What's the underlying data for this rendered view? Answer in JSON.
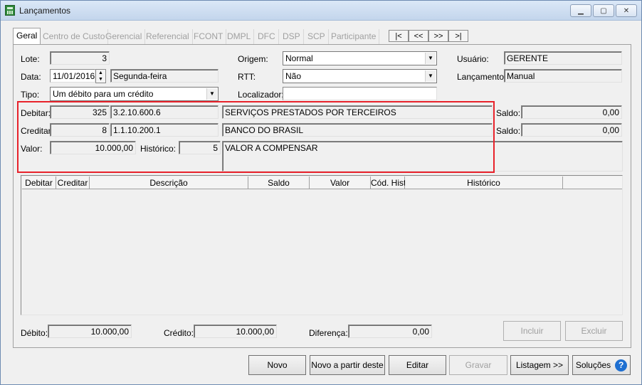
{
  "window": {
    "title": "Lançamentos"
  },
  "tabs": [
    "Geral",
    "Centro de Custo",
    "Gerencial",
    "Referencial",
    "FCONT",
    "DMPL",
    "DFC",
    "DSP",
    "SCP",
    "Participante"
  ],
  "nav": {
    "first": "|<",
    "prev": "<<",
    "next": ">>",
    "last": ">|"
  },
  "form": {
    "lote_label": "Lote:",
    "lote_value": "3",
    "data_label": "Data:",
    "data_value": "11/01/2016",
    "weekday": "Segunda-feira",
    "tipo_label": "Tipo:",
    "tipo_value": "Um débito para um crédito",
    "origem_label": "Origem:",
    "origem_value": "Normal",
    "rtt_label": "RTT:",
    "rtt_value": "Não",
    "localizador_label": "Localizador:",
    "localizador_value": "",
    "usuario_label": "Usuário:",
    "usuario_value": "GERENTE",
    "lancamento_label": "Lançamento:",
    "lancamento_value": "Manual"
  },
  "entry": {
    "debitar_label": "Debitar:",
    "debitar_code": "325",
    "debitar_account": "3.2.10.600.6",
    "debitar_desc": "SERVIÇOS PRESTADOS POR TERCEIROS",
    "creditar_label": "Creditar:",
    "creditar_code": "8",
    "creditar_account": "1.1.10.200.1",
    "creditar_desc": "BANCO DO BRASIL",
    "valor_label": "Valor:",
    "valor_value": "10.000,00",
    "historico_label": "Histórico:",
    "historico_code": "5",
    "historico_desc": "VALOR A COMPENSAR",
    "saldo_label": "Saldo:",
    "saldo_debitar": "0,00",
    "saldo_creditar": "0,00"
  },
  "grid": {
    "columns": [
      "Debitar",
      "Creditar",
      "Descrição",
      "Saldo",
      "Valor",
      "Cód. Hist.",
      "Histórico"
    ]
  },
  "totals": {
    "debito_label": "Débito:",
    "debito_value": "10.000,00",
    "credito_label": "Crédito:",
    "credito_value": "10.000,00",
    "diferenca_label": "Diferença:",
    "diferenca_value": "0,00"
  },
  "buttons": {
    "incluir": "Incluir",
    "excluir": "Excluir",
    "novo": "Novo",
    "novo_partir": "Novo a partir deste",
    "editar": "Editar",
    "gravar": "Gravar",
    "listagem": "Listagem >>",
    "solucoes": "Soluções"
  }
}
